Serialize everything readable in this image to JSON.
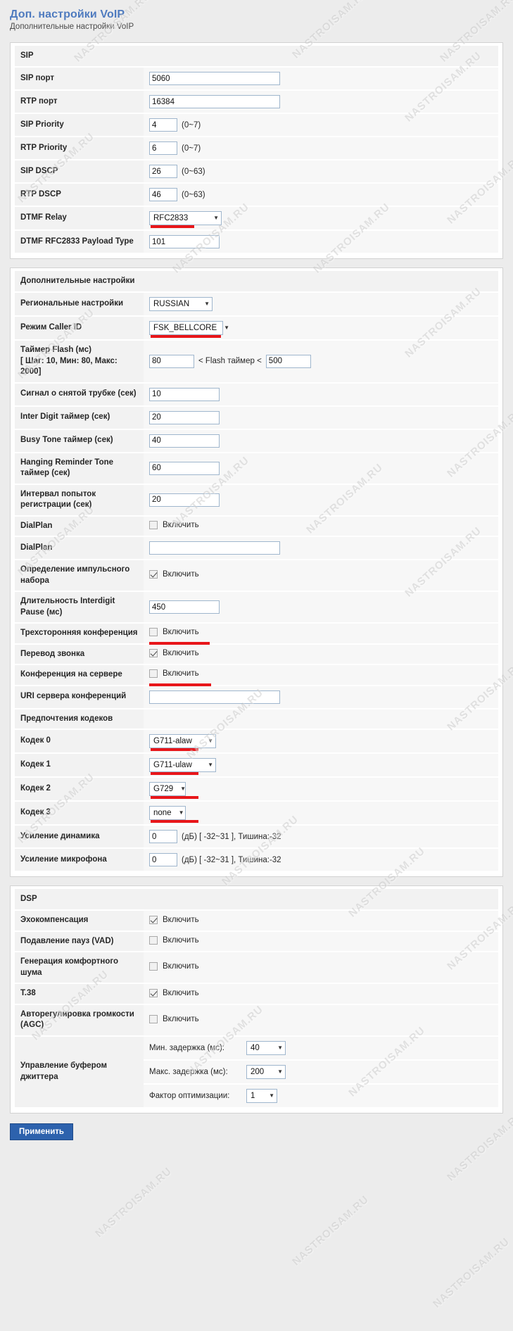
{
  "header": {
    "title": "Доп. настройки VoIP",
    "subtitle": "Дополнительные настройки VoIP"
  },
  "common": {
    "enable_label": "Включить",
    "dropdown_arrow": "▼"
  },
  "watermark": {
    "text": "NASTROISAM.RU"
  },
  "sip_panel": {
    "section_title": "SIP",
    "rows": [
      {
        "label": "SIP порт",
        "value": "5060"
      },
      {
        "label": "RTP порт",
        "value": "16384"
      },
      {
        "label": "SIP Priority",
        "value": "4",
        "hint": "(0~7)"
      },
      {
        "label": "RTP Priority",
        "value": "6",
        "hint": "(0~7)"
      },
      {
        "label": "SIP DSCP",
        "value": "26",
        "hint": "(0~63)"
      },
      {
        "label": "RTP DSCP",
        "value": "46",
        "hint": "(0~63)"
      },
      {
        "label": "DTMF Relay",
        "value": "RFC2833"
      },
      {
        "label": "DTMF RFC2833 Payload Type",
        "value": "101"
      }
    ]
  },
  "extra_panel": {
    "section_title": "Дополнительные настройки",
    "regional_label": "Региональные настройки",
    "regional_value": "RUSSIAN",
    "callerid_label": "Режим Caller ID",
    "callerid_value": "FSK_BELLCORE",
    "flash_label_line1": "Таймер Flash (мс)",
    "flash_label_line2": "[ Шаг: 10, Мин: 80, Макс: 2000]",
    "flash_min": "80",
    "flash_mid": "< Flash таймер <",
    "flash_max": "500",
    "offhook_label": "Сигнал о снятой трубке (сек)",
    "offhook_value": "10",
    "interdigit_label": "Inter Digit таймер (сек)",
    "interdigit_value": "20",
    "busytone_label": "Busy Tone таймер (сек)",
    "busytone_value": "40",
    "hanging_label": "Hanging Reminder Tone таймер (сек)",
    "hanging_value": "60",
    "reginterval_label": "Интервал попыток регистрации (сек)",
    "reginterval_value": "20",
    "dialplan_chk_label": "DialPlan",
    "dialplan_chk_checked": false,
    "dialplan_txt_label": "DialPlan",
    "dialplan_txt_value": "",
    "pulse_label": "Определение импульсного набора",
    "pulse_checked": true,
    "interdigit_pause_label": "Длительность Interdigit Pause (мс)",
    "interdigit_pause_value": "450",
    "threeway_label": "Трехсторонняя конференция",
    "threeway_checked": false,
    "calltransfer_label": "Перевод звонка",
    "calltransfer_checked": true,
    "serverconf_label": "Конференция на сервере",
    "serverconf_checked": false,
    "confuri_label": "URI сервера конференций",
    "confuri_value": "",
    "codec_pref_label": "Предпочтения кодеков",
    "codecs": [
      {
        "label": "Кодек 0",
        "value": "G711-alaw"
      },
      {
        "label": "Кодек 1",
        "value": "G711-ulaw"
      },
      {
        "label": "Кодек 2",
        "value": "G729"
      },
      {
        "label": "Кодек 3",
        "value": "none"
      }
    ],
    "spk_gain_label": "Усиление динамика",
    "spk_gain_value": "0",
    "spk_gain_hint": "(дБ) [ -32~31 ], Тишина:-32",
    "mic_gain_label": "Усиление микрофона",
    "mic_gain_value": "0",
    "mic_gain_hint": "(дБ) [ -32~31 ], Тишина:-32"
  },
  "dsp_panel": {
    "section_title": "DSP",
    "echo_label": "Эхокомпенсация",
    "echo_checked": true,
    "vad_label": "Подавление пауз (VAD)",
    "vad_checked": false,
    "cng_label": "Генерация комфортного шума",
    "cng_checked": false,
    "t38_label": "T.38",
    "t38_checked": true,
    "agc_label": "Авторегулировка громкости (AGC)",
    "agc_checked": false,
    "jitter_label": "Управление буфером джиттера",
    "jitter_rows": [
      {
        "label": "Мин. задержка (мс):",
        "value": "40"
      },
      {
        "label": "Макс. задержка (мс):",
        "value": "200"
      },
      {
        "label": "Фактор оптимизации:",
        "value": "1"
      }
    ]
  },
  "footer": {
    "apply_label": "Применить"
  },
  "colors": {
    "title": "#4f7bbf",
    "marker": "#e8161a",
    "button": "#2d62ad"
  }
}
